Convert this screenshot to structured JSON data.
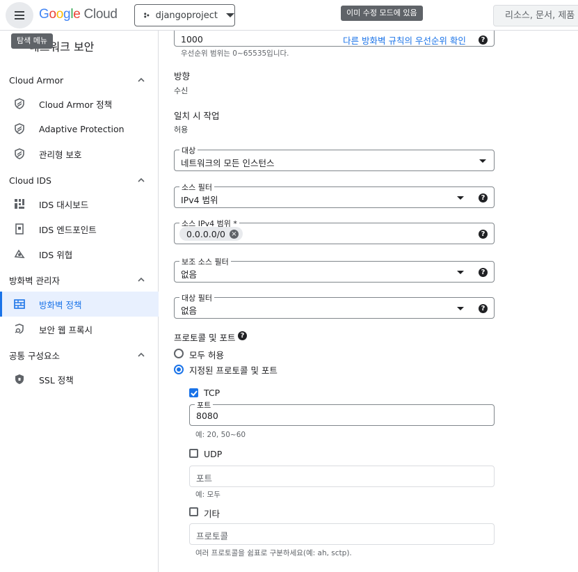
{
  "header": {
    "logo": {
      "g1": "G",
      "g2": "o",
      "g3": "o",
      "g4": "g",
      "g5": "l",
      "g6": "e",
      "cloud": " Cloud"
    },
    "project": "djangoproject",
    "edit_chip": "이미 수정 모드에 있음",
    "search_placeholder": "리소스, 문서, 제품",
    "menu_tooltip": "탐색 메뉴"
  },
  "sidebar": {
    "title": "네트워크 보안",
    "sections": [
      {
        "label": "Cloud Armor",
        "items": [
          {
            "label": "Cloud Armor 정책",
            "icon": "shield-icon"
          },
          {
            "label": "Adaptive Protection",
            "icon": "shield-icon"
          },
          {
            "label": "관리형 보호",
            "icon": "shield-icon"
          }
        ]
      },
      {
        "label": "Cloud IDS",
        "items": [
          {
            "label": "IDS 대시보드",
            "icon": "dashboard-icon"
          },
          {
            "label": "IDS 엔드포인트",
            "icon": "endpoint-icon"
          },
          {
            "label": "IDS 위협",
            "icon": "threat-icon"
          }
        ]
      },
      {
        "label": "방화벽 관리자",
        "items": [
          {
            "label": "방화벽 정책",
            "icon": "firewall-icon"
          },
          {
            "label": "보안 웹 프록시",
            "icon": "proxy-icon"
          }
        ]
      },
      {
        "label": "공통 구성요소",
        "items": [
          {
            "label": "SSL 정책",
            "icon": "ssl-shield-icon"
          }
        ]
      }
    ]
  },
  "form": {
    "priority_value": "1000",
    "priority_link": "다른 방화벽 규칙의 우선순위 확인",
    "priority_hint": "우선순위 범위는 0~65535입니다.",
    "direction_label": "방향",
    "direction_value": "수신",
    "action_label": "일치 시 작업",
    "action_value": "허용",
    "target_label": "대상",
    "target_value": "네트워크의 모든 인스턴스",
    "source_filter_label": "소스 필터",
    "source_filter_value": "IPv4 범위",
    "source_ipv4_label": "소스 IPv4 범위 *",
    "source_ipv4_chip": "0.0.0.0/0",
    "secondary_filter_label": "보조 소스 필터",
    "secondary_filter_value": "없음",
    "dest_filter_label": "대상 필터",
    "dest_filter_value": "없음",
    "protocols_label": "프로토콜 및 포트",
    "allow_all": "모두 허용",
    "specified": "지정된 프로토콜 및 포트",
    "tcp_label": "TCP",
    "tcp_port_label": "포트",
    "tcp_port_value": "8080",
    "tcp_hint": "예: 20, 50~60",
    "udp_label": "UDP",
    "udp_port_placeholder": "포트",
    "udp_hint": "예: 모두",
    "other_label": "기타",
    "other_placeholder": "프로토콜",
    "other_hint": "여러 프로토콜을 쉼표로 구분하세요(예: ah, sctp)."
  }
}
